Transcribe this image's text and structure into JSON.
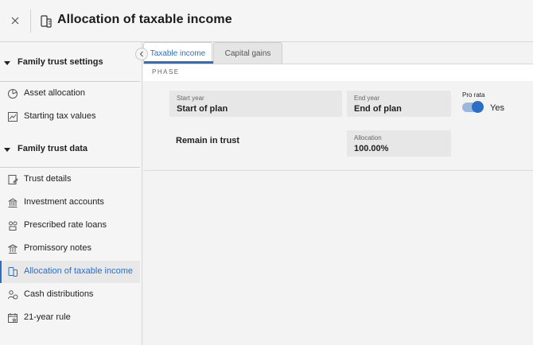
{
  "header": {
    "title": "Allocation of taxable income"
  },
  "sidebar": {
    "sections": [
      {
        "label": "Family trust settings",
        "items": [
          {
            "label": "Asset allocation",
            "icon": "pie-chart-icon"
          },
          {
            "label": "Starting tax values",
            "icon": "chart-image-icon"
          }
        ]
      },
      {
        "label": "Family trust data",
        "items": [
          {
            "label": "Trust details",
            "icon": "document-edit-icon"
          },
          {
            "label": "Investment accounts",
            "icon": "bank-building-icon"
          },
          {
            "label": "Prescribed rate loans",
            "icon": "people-loan-icon"
          },
          {
            "label": "Promissory notes",
            "icon": "institution-icon"
          },
          {
            "label": "Allocation of taxable income",
            "icon": "document-split-icon",
            "active": true
          },
          {
            "label": "Cash distributions",
            "icon": "person-money-icon"
          },
          {
            "label": "21-year rule",
            "icon": "calendar-star-icon"
          }
        ]
      }
    ]
  },
  "tabs": [
    {
      "label": "Taxable income",
      "active": true
    },
    {
      "label": "Capital gains",
      "active": false
    }
  ],
  "phase": {
    "label": "PHASE",
    "start_year": {
      "label": "Start year",
      "value": "Start of plan"
    },
    "end_year": {
      "label": "End year",
      "value": "End of plan"
    },
    "pro_rata": {
      "label": "Pro rata",
      "state": "Yes",
      "on": true
    },
    "remain_in_trust": {
      "label": "Remain in trust"
    },
    "allocation": {
      "label": "Allocation",
      "value": "100.00%"
    }
  },
  "colors": {
    "accent": "#2d6ec5",
    "toggle_track": "#9bb7dc"
  }
}
